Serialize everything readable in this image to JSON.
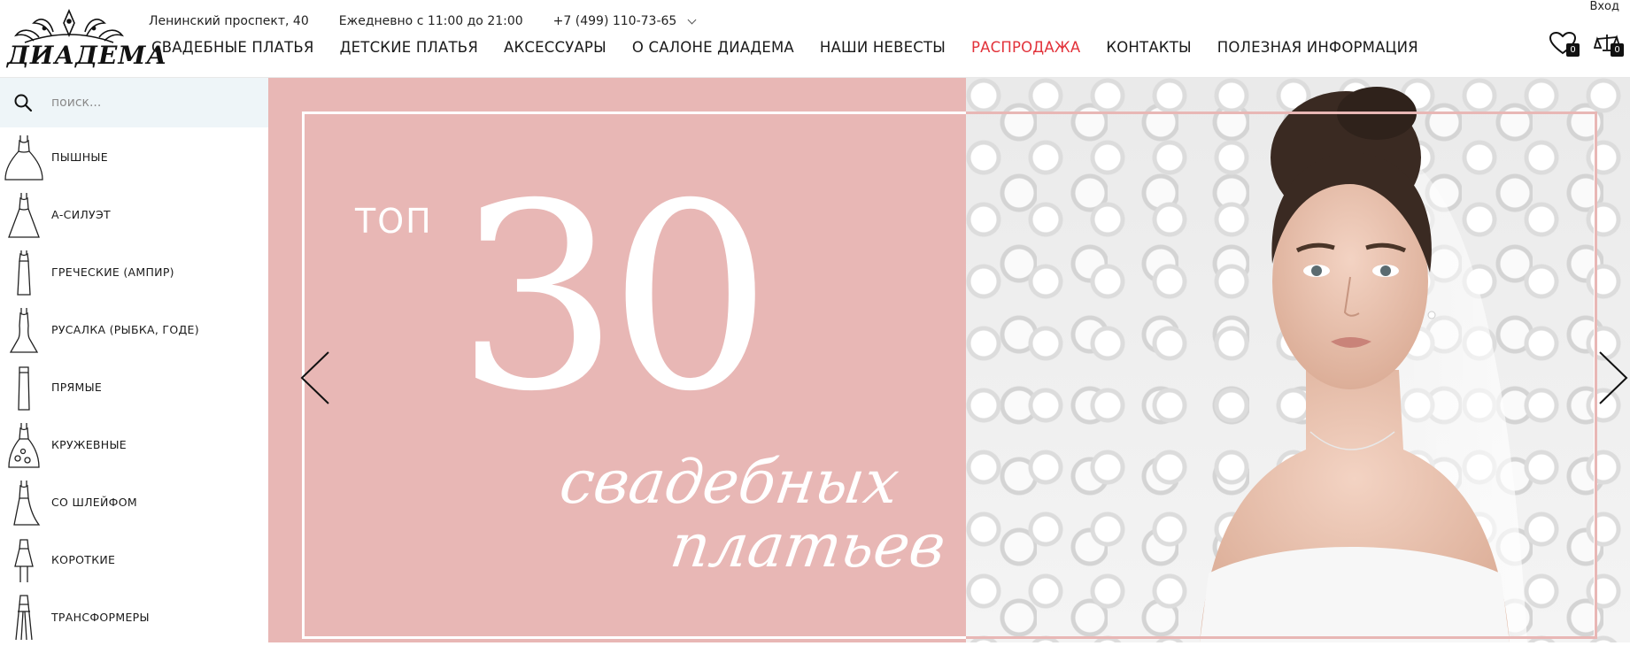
{
  "header": {
    "logo_text": "ДИАДЕМА",
    "address": "Ленинский проспект, 40",
    "hours": "Ежедневно с 11:00 до 21:00",
    "phone": "+7 (499) 110-73-65",
    "login_label": "Вход",
    "favorites_count": "0",
    "compare_count": "0",
    "nav": [
      {
        "label": "СВАДЕБНЫЕ ПЛАТЬЯ"
      },
      {
        "label": "ДЕТСКИЕ ПЛАТЬЯ"
      },
      {
        "label": "АКСЕССУАРЫ"
      },
      {
        "label": "О САЛОНЕ ДИАДЕМА"
      },
      {
        "label": "НАШИ НЕВЕСТЫ"
      },
      {
        "label": "РАСПРОДАЖА"
      },
      {
        "label": "КОНТАКТЫ"
      },
      {
        "label": "ПОЛЕЗНАЯ ИНФОРМАЦИЯ"
      }
    ],
    "colors": {
      "sale": "#e2323a",
      "text": "#1a1a1a"
    }
  },
  "sidebar": {
    "search": {
      "placeholder": "поиск..."
    },
    "categories": [
      {
        "label": "ПЫШНЫЕ",
        "icon": "ball-gown-dress-icon"
      },
      {
        "label": "А-СИЛУЭТ",
        "icon": "a-line-dress-icon"
      },
      {
        "label": "ГРЕЧЕСКИЕ (АМПИР)",
        "icon": "empire-dress-icon"
      },
      {
        "label": "РУСАЛКА (РЫБКА, ГОДЕ)",
        "icon": "mermaid-dress-icon"
      },
      {
        "label": "ПРЯМЫЕ",
        "icon": "straight-dress-icon"
      },
      {
        "label": "КРУЖЕВНЫЕ",
        "icon": "lace-dress-icon"
      },
      {
        "label": "СО ШЛЕЙФОМ",
        "icon": "train-dress-icon"
      },
      {
        "label": "КОРОТКИЕ",
        "icon": "short-dress-icon"
      },
      {
        "label": "ТРАНСФОРМЕРЫ",
        "icon": "transformer-dress-icon"
      }
    ]
  },
  "banner": {
    "top_label": "ТОП",
    "number": "30",
    "script_line1": "свадебных",
    "script_line2": "платьев",
    "colors": {
      "background": "#e8b7b5",
      "text": "#ffffff"
    }
  }
}
